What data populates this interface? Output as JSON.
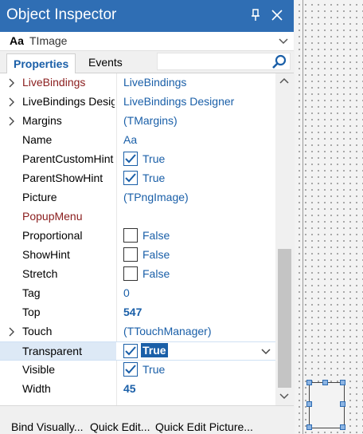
{
  "window": {
    "title": "Object Inspector"
  },
  "object_selector": {
    "prefix": "Aa",
    "object_name": "TImage"
  },
  "tabs": [
    {
      "label": "Properties",
      "active": true
    },
    {
      "label": "Events",
      "active": false
    }
  ],
  "properties": [
    {
      "name": "LiveBindings",
      "value": "LiveBindings",
      "expandable": true,
      "name_red": true
    },
    {
      "name": "LiveBindings Designer",
      "value": "LiveBindings Designer",
      "expandable": true
    },
    {
      "name": "Margins",
      "value": "(TMargins)",
      "expandable": true
    },
    {
      "name": "Name",
      "value": "Aa"
    },
    {
      "name": "ParentCustomHint",
      "value": "True",
      "checkbox": true,
      "checked": true
    },
    {
      "name": "ParentShowHint",
      "value": "True",
      "checkbox": true,
      "checked": true
    },
    {
      "name": "Picture",
      "value": "(TPngImage)"
    },
    {
      "name": "PopupMenu",
      "value": "",
      "name_red": true
    },
    {
      "name": "Proportional",
      "value": "False",
      "checkbox": true,
      "checked": false
    },
    {
      "name": "ShowHint",
      "value": "False",
      "checkbox": true,
      "checked": false
    },
    {
      "name": "Stretch",
      "value": "False",
      "checkbox": true,
      "checked": false
    },
    {
      "name": "Tag",
      "value": "0"
    },
    {
      "name": "Top",
      "value": "547",
      "bold": true
    },
    {
      "name": "Touch",
      "value": "(TTouchManager)",
      "expandable": true
    },
    {
      "name": "Transparent",
      "value": "True",
      "checkbox": true,
      "checked": true,
      "selected": true
    },
    {
      "name": "Visible",
      "value": "True",
      "checkbox": true,
      "checked": true
    },
    {
      "name": "Width",
      "value": "45",
      "bold": true
    }
  ],
  "bottom_links": [
    {
      "label": "Bind Visually..."
    },
    {
      "label": "Quick Edit..."
    },
    {
      "label": "Quick Edit Picture..."
    }
  ],
  "colors": {
    "titlebar": "#2f6eb4",
    "value_text": "#1a5fa8",
    "red_property": "#8a1d1d",
    "selection": "#1a5fa8"
  },
  "icons": {
    "pin": "pin-icon",
    "close": "close-icon",
    "search": "search-icon",
    "dropdown": "chevron-down-icon",
    "expand": "chevron-right-icon",
    "check": "checkmark-icon"
  }
}
